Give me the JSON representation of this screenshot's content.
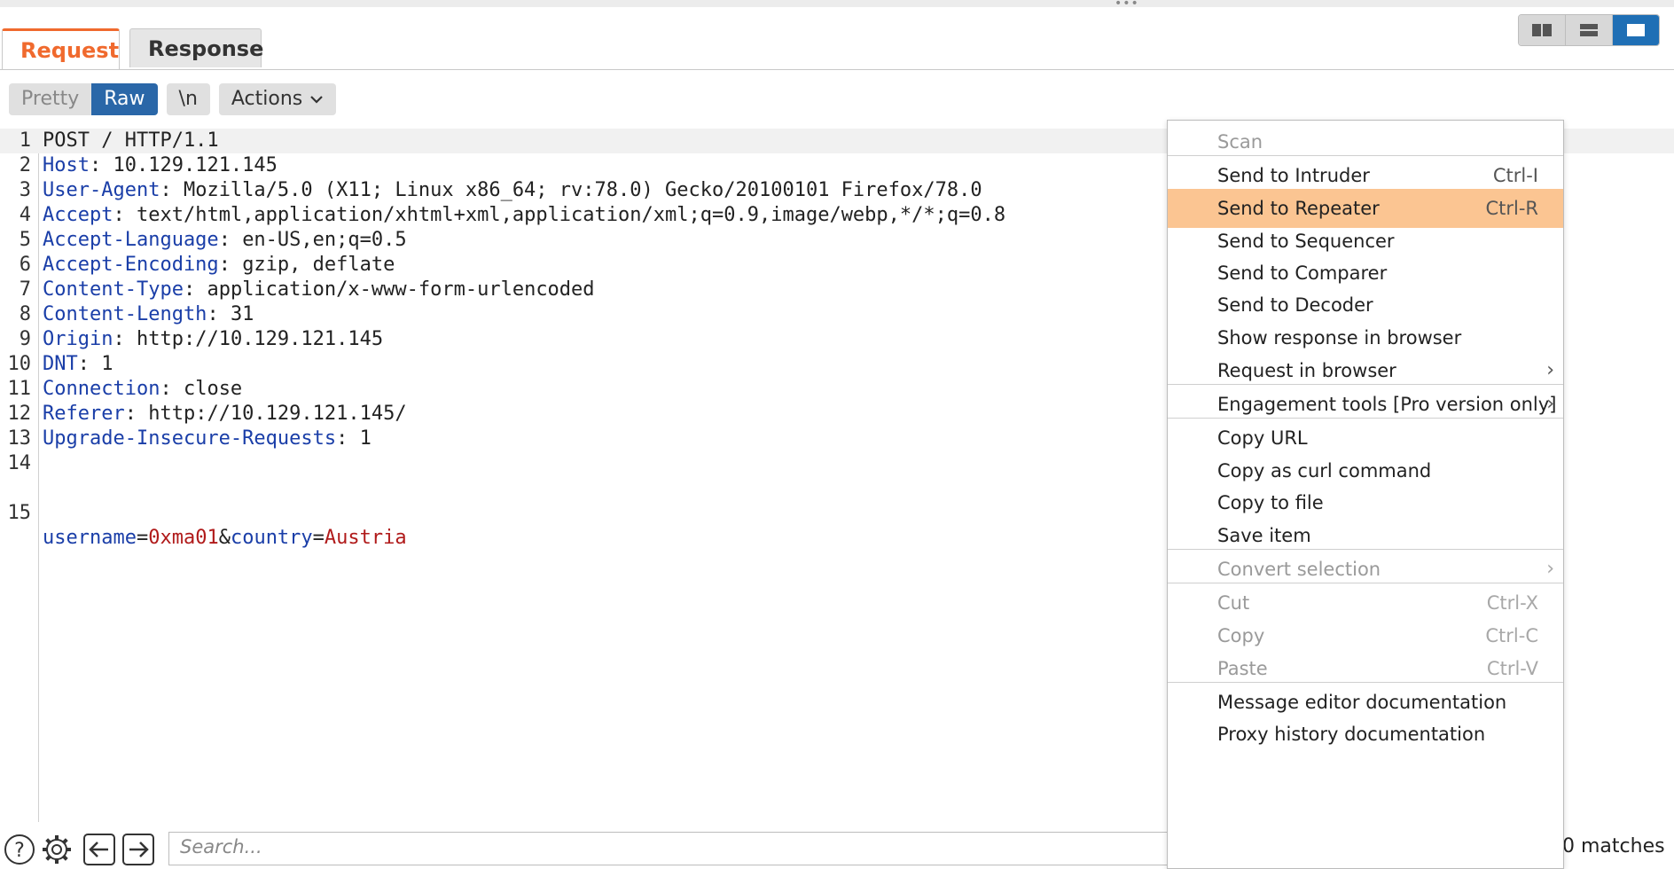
{
  "tabs": [
    {
      "label": "Request",
      "active": true
    },
    {
      "label": "Response",
      "active": false
    }
  ],
  "view_toggles": [
    "columns-icon",
    "rows-icon",
    "single-pane-icon"
  ],
  "toolbar": {
    "pretty_label": "Pretty",
    "raw_label": "Raw",
    "newline_label": "\\n",
    "actions_label": "Actions"
  },
  "editor": {
    "lines": [
      {
        "num": "1",
        "key": "",
        "sep": "",
        "text": "POST / HTTP/1.1"
      },
      {
        "num": "2",
        "key": "Host",
        "sep": ": ",
        "text": "10.129.121.145"
      },
      {
        "num": "3",
        "key": "User-Agent",
        "sep": ": ",
        "text": "Mozilla/5.0 (X11; Linux x86_64; rv:78.0) Gecko/20100101 Firefox/78.0"
      },
      {
        "num": "4",
        "key": "Accept",
        "sep": ": ",
        "text": "text/html,application/xhtml+xml,application/xml;q=0.9,image/webp,*/*;q=0.8"
      },
      {
        "num": "5",
        "key": "Accept-Language",
        "sep": ": ",
        "text": "en-US,en;q=0.5"
      },
      {
        "num": "6",
        "key": "Accept-Encoding",
        "sep": ": ",
        "text": "gzip, deflate"
      },
      {
        "num": "7",
        "key": "Content-Type",
        "sep": ": ",
        "text": "application/x-www-form-urlencoded"
      },
      {
        "num": "8",
        "key": "Content-Length",
        "sep": ": ",
        "text": "31"
      },
      {
        "num": "9",
        "key": "Origin",
        "sep": ": ",
        "text": "http://10.129.121.145"
      },
      {
        "num": "10",
        "key": "DNT",
        "sep": ": ",
        "text": "1"
      },
      {
        "num": "11",
        "key": "Connection",
        "sep": ": ",
        "text": "close"
      },
      {
        "num": "12",
        "key": "Referer",
        "sep": ": ",
        "text": "http://10.129.121.145/"
      },
      {
        "num": "13",
        "key": "Upgrade-Insecure-Requests",
        "sep": ": ",
        "text": "1"
      },
      {
        "num": "14",
        "key": "",
        "sep": "",
        "text": ""
      }
    ],
    "body_line": {
      "num": "15",
      "param1_key": "username",
      "eq1": "=",
      "param1_val": "0xma01",
      "amp": "&",
      "param2_key": "country",
      "eq2": "=",
      "param2_val": "Austria"
    }
  },
  "bottom": {
    "search_placeholder": "Search...",
    "matches": "0 matches"
  },
  "context_menu": {
    "items": [
      {
        "label": "Scan",
        "shortcut": "",
        "submenu": false,
        "disabled": true,
        "highlighted": false
      },
      {
        "label": "Send to Intruder",
        "shortcut": "Ctrl-I",
        "submenu": false,
        "disabled": false,
        "highlighted": false
      },
      {
        "label": "Send to Repeater",
        "shortcut": "Ctrl-R",
        "submenu": false,
        "disabled": false,
        "highlighted": true
      },
      {
        "label": "Send to Sequencer",
        "shortcut": "",
        "submenu": false,
        "disabled": false,
        "highlighted": false
      },
      {
        "label": "Send to Comparer",
        "shortcut": "",
        "submenu": false,
        "disabled": false,
        "highlighted": false
      },
      {
        "label": "Send to Decoder",
        "shortcut": "",
        "submenu": false,
        "disabled": false,
        "highlighted": false
      },
      {
        "label": "Show response in browser",
        "shortcut": "",
        "submenu": false,
        "disabled": false,
        "highlighted": false
      },
      {
        "label": "Request in browser",
        "shortcut": "",
        "submenu": true,
        "disabled": false,
        "highlighted": false
      },
      {
        "label": "Engagement tools [Pro version only]",
        "shortcut": "",
        "submenu": true,
        "disabled": false,
        "highlighted": false
      },
      {
        "label": "Copy URL",
        "shortcut": "",
        "submenu": false,
        "disabled": false,
        "highlighted": false
      },
      {
        "label": "Copy as curl command",
        "shortcut": "",
        "submenu": false,
        "disabled": false,
        "highlighted": false
      },
      {
        "label": "Copy to file",
        "shortcut": "",
        "submenu": false,
        "disabled": false,
        "highlighted": false
      },
      {
        "label": "Save item",
        "shortcut": "",
        "submenu": false,
        "disabled": false,
        "highlighted": false
      },
      {
        "label": "Convert selection",
        "shortcut": "",
        "submenu": true,
        "disabled": true,
        "highlighted": false
      },
      {
        "label": "Cut",
        "shortcut": "Ctrl-X",
        "submenu": false,
        "disabled": true,
        "highlighted": false
      },
      {
        "label": "Copy",
        "shortcut": "Ctrl-C",
        "submenu": false,
        "disabled": true,
        "highlighted": false
      },
      {
        "label": "Paste",
        "shortcut": "Ctrl-V",
        "submenu": false,
        "disabled": true,
        "highlighted": false
      },
      {
        "label": "Message editor documentation",
        "shortcut": "",
        "submenu": false,
        "disabled": false,
        "highlighted": false
      },
      {
        "label": "Proxy history documentation",
        "shortcut": "",
        "submenu": false,
        "disabled": false,
        "highlighted": false
      }
    ]
  },
  "colors": {
    "accent_orange": "#f06a2e",
    "raw_active": "#2a67a8",
    "header_key": "#1a3ea8",
    "param_value": "#b01a1a",
    "menu_highlight": "#fbc592"
  }
}
